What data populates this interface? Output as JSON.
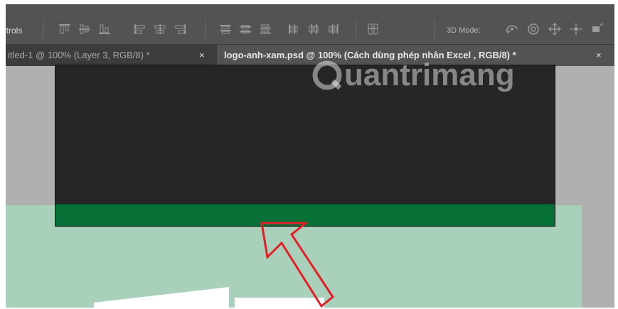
{
  "options_bar": {
    "label": "ntrols",
    "mode_label": "3D Mode:",
    "align_icons": [
      "align-top-edges-icon",
      "align-vertical-centers-icon",
      "align-bottom-edges-icon",
      "align-left-edges-icon",
      "align-horizontal-centers-icon",
      "align-right-edges-icon"
    ],
    "distribute_icons": [
      "distribute-top-icon",
      "distribute-vertical-center-icon",
      "distribute-bottom-icon",
      "distribute-left-icon",
      "distribute-horizontal-center-icon",
      "distribute-right-icon"
    ],
    "auto_align_icon": "auto-align-layers-icon",
    "mode_icons": [
      "rotate-3d-icon",
      "roll-3d-icon",
      "drag-3d-icon",
      "slide-3d-icon",
      "scale-3d-icon"
    ]
  },
  "tabs": [
    {
      "title": "itled-1 @ 100% (Layer 3, RGB/8) *",
      "close": "×",
      "active": false
    },
    {
      "title": "logo-anh-xam.psd @ 100% (Cách dùng phép nhân Excel , RGB/8) *",
      "close": "×",
      "active": true
    }
  ],
  "watermark": {
    "text": "uantrimang"
  },
  "colors": {
    "popup_bg": "#262626",
    "popup_strip": "#067037",
    "document_bg": "#a9d0bb",
    "arrow": "#e31e24",
    "workspace": "#b0b0b0"
  }
}
